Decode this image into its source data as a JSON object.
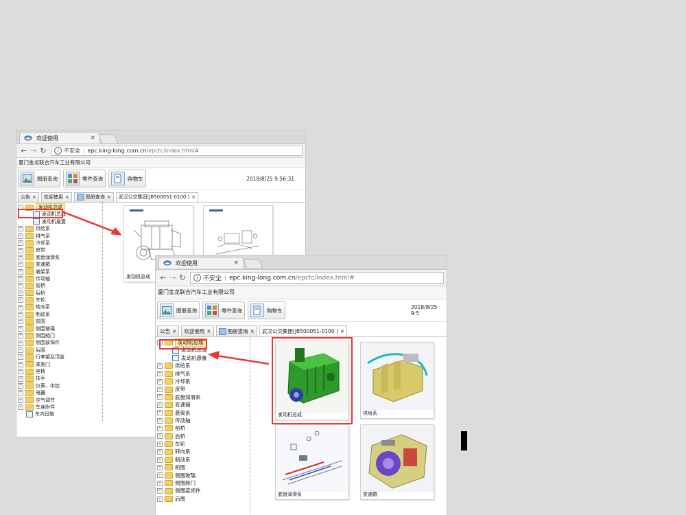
{
  "browser": {
    "tab_title": "欢迎使用",
    "tab_close": "×",
    "insecure_label": "不安全",
    "url_host": "epc.king-long.com.cn",
    "url_path": "/epctc/index.html#"
  },
  "app": {
    "company": "厦门金龙联合汽车工业有限公司",
    "toolbar": {
      "catalog": "图册查询",
      "parts": "零件查询",
      "cart": "购物车"
    },
    "datetime": "2018/8/25 9:56:31",
    "datetime_partial": "2018/8/25 9:5",
    "tabs": [
      {
        "label": "公告",
        "close": "×"
      },
      {
        "label": "欢迎使用",
        "close": "×"
      },
      {
        "label": "图册查询",
        "close": "×"
      },
      {
        "label": "武汉公交集团(JB500051-0100 )",
        "close": "×"
      }
    ]
  },
  "tree": {
    "root": {
      "pm": "−",
      "label": "发动机总成"
    },
    "children": [
      "发动机总成",
      "发动机悬置"
    ],
    "items": [
      "供给系",
      "排气系",
      "冷却系",
      "皮带",
      "底盘润滑系",
      "变速箱",
      "悬架系",
      "传动轴",
      "前桥",
      "后桥",
      "车轮",
      "转向系",
      "制动系",
      "前围",
      "侧围玻璃",
      "侧围舱门",
      "侧围装饰件",
      "后围",
      "行李架及顶盖",
      "乘客门",
      "座椅",
      "扶手",
      "仪表、中控",
      "电器",
      "空气调节",
      "车身附件"
    ],
    "last_item": "车内设施",
    "expander": "+"
  },
  "win1_thumbs": [
    {
      "caption": "发动机总成"
    }
  ],
  "win2_thumbs": [
    {
      "caption": "发动机总成"
    },
    {
      "caption": "供给系"
    },
    {
      "caption": "底盘润滑系"
    },
    {
      "caption": "变速箱"
    }
  ],
  "colors": {
    "highlight": "#e53935",
    "arrow": "#e53935",
    "selected_node": "#fde9a8",
    "folder": "#f2cf62"
  }
}
